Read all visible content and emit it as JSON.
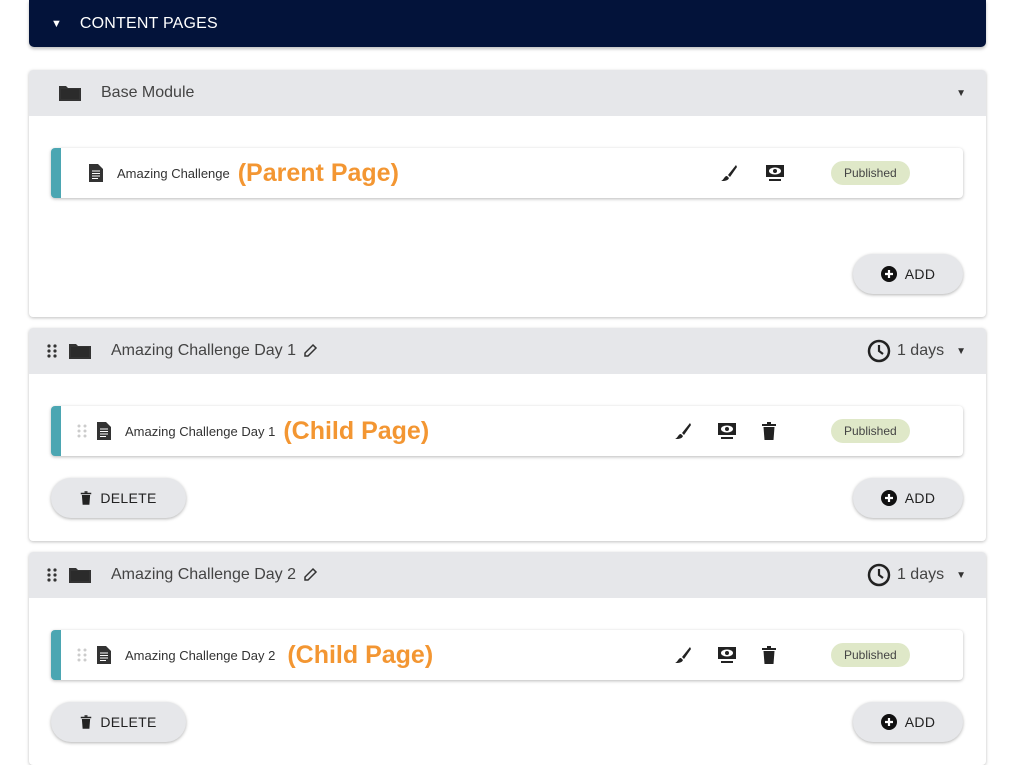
{
  "header": {
    "title": "CONTENT PAGES",
    "toggle_icon": "triangle-down-icon"
  },
  "modules": [
    {
      "name": "Base Module",
      "icon": "folder-icon",
      "draggable": false,
      "editable": false,
      "duration": null,
      "pages": [
        {
          "name": "Amazing Challenge",
          "annotation": "(Parent Page)",
          "status": "Published",
          "actions": [
            "brush-icon",
            "preview-icon"
          ]
        }
      ],
      "buttons": {
        "add": "ADD"
      }
    },
    {
      "name": "Amazing Challenge Day 1",
      "icon": "folder-icon",
      "draggable": true,
      "editable": true,
      "duration": "1 days",
      "pages": [
        {
          "name": "Amazing Challenge Day 1",
          "annotation": "(Child Page)",
          "status": "Published",
          "actions": [
            "brush-icon",
            "preview-icon",
            "trash-icon"
          ]
        }
      ],
      "buttons": {
        "delete": "DELETE",
        "add": "ADD"
      }
    },
    {
      "name": "Amazing Challenge Day 2",
      "icon": "folder-icon",
      "draggable": true,
      "editable": true,
      "duration": "1 days",
      "pages": [
        {
          "name": "Amazing Challenge Day 2",
          "annotation": "(Child Page)",
          "status": "Published",
          "actions": [
            "brush-icon",
            "preview-icon",
            "trash-icon"
          ]
        }
      ],
      "buttons": {
        "delete": "DELETE",
        "add": "ADD"
      }
    }
  ],
  "colors": {
    "header_bg": "#03133a",
    "accent_bar": "#4ba6b2",
    "annotation": "#f39632",
    "badge_bg": "#dfe8c8"
  }
}
